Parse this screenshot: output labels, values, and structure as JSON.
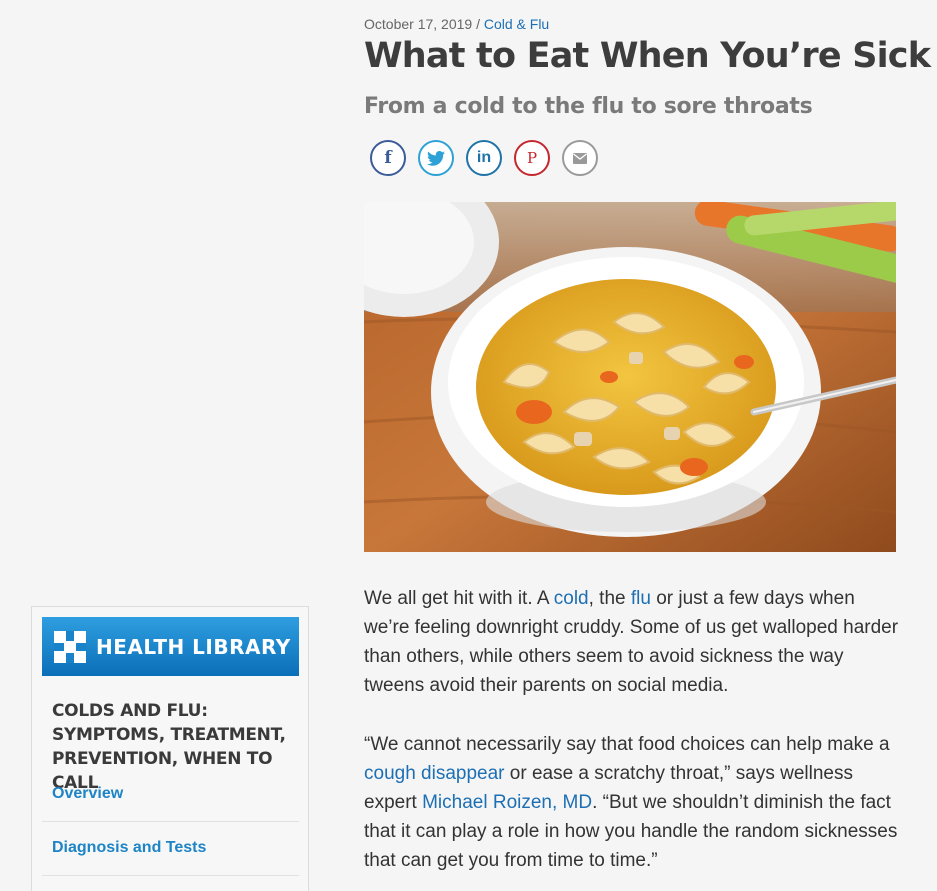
{
  "article": {
    "date": "October 17, 2019",
    "separator": "/",
    "category": "Cold & Flu",
    "title": "What to Eat When You’re Sick",
    "subtitle": "From a cold to the flu to sore throats",
    "para1": {
      "t1": "We all get hit with it. A ",
      "link_cold": "cold",
      "t2": ", the ",
      "link_flu": "flu",
      "t3": " or just a few days when we’re feeling downright cruddy. Some of us get walloped harder than others, while others seem to avoid sickness the way tweens avoid their parents on social media."
    },
    "para2": {
      "t1": "“We cannot necessarily say that food choices can help make a ",
      "link_cough": "cough disappear",
      "t2": " or ease a scratchy throat,” says wellness expert ",
      "link_expert": "Michael Roizen, MD",
      "t3": ". “But we shouldn’t diminish the fact that it can play a role in how you handle the random sicknesses that can get you from time to time.”"
    }
  },
  "share": {
    "facebook": "f",
    "twitter": "twitter-bird-icon",
    "linkedin": "in",
    "pinterest": "P",
    "email": "envelope-icon",
    "colors": {
      "facebook": "#3b5b99",
      "twitter": "#2ea1d6",
      "linkedin": "#1f73a8",
      "pinterest": "#c4282e",
      "email": "#9a9a9a"
    }
  },
  "sidebar": {
    "banner": "HEALTH LIBRARY",
    "heading": "COLDS AND FLU: SYMPTOMS, TREATMENT, PREVENTION, WHEN TO CALL",
    "links": [
      "Overview",
      "Diagnosis and Tests"
    ],
    "accent": "#1d84c5"
  }
}
